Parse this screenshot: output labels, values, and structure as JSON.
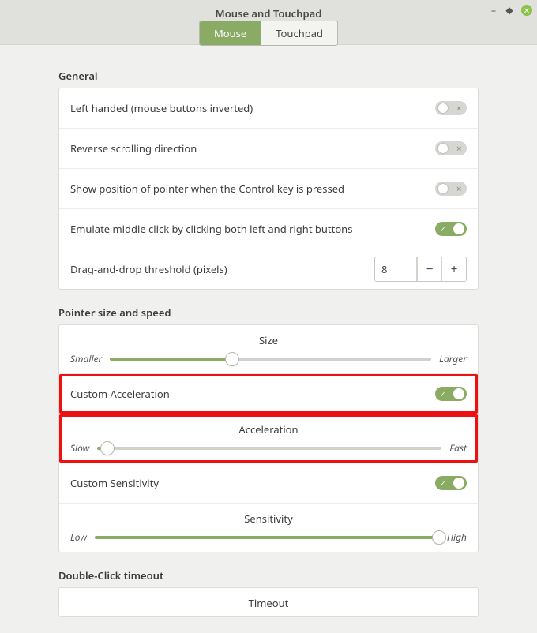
{
  "window": {
    "title": "Mouse and Touchpad"
  },
  "tabs": {
    "mouse": "Mouse",
    "touchpad": "Touchpad"
  },
  "sections": {
    "general": "General",
    "pointer": "Pointer size and speed",
    "doubleclick": "Double-Click timeout"
  },
  "general": {
    "left_handed": {
      "label": "Left handed (mouse buttons inverted)",
      "on": false
    },
    "reverse_scroll": {
      "label": "Reverse scrolling direction",
      "on": false
    },
    "show_position": {
      "label": "Show position of pointer when the Control key is pressed",
      "on": false
    },
    "emulate_middle": {
      "label": "Emulate middle click by clicking both left and right buttons",
      "on": true
    },
    "drag_threshold": {
      "label": "Drag-and-drop threshold (pixels)",
      "value": "8"
    }
  },
  "pointer": {
    "size": {
      "label": "Size",
      "min": "Smaller",
      "max": "Larger",
      "percent": 38
    },
    "custom_accel": {
      "label": "Custom Acceleration",
      "on": true
    },
    "acceleration": {
      "label": "Acceleration",
      "min": "Slow",
      "max": "Fast",
      "percent": 3
    },
    "custom_sens": {
      "label": "Custom Sensitivity",
      "on": true
    },
    "sensitivity": {
      "label": "Sensitivity",
      "min": "Low",
      "max": "High",
      "percent": 100
    }
  },
  "doubleclick": {
    "timeout": {
      "label": "Timeout"
    }
  }
}
